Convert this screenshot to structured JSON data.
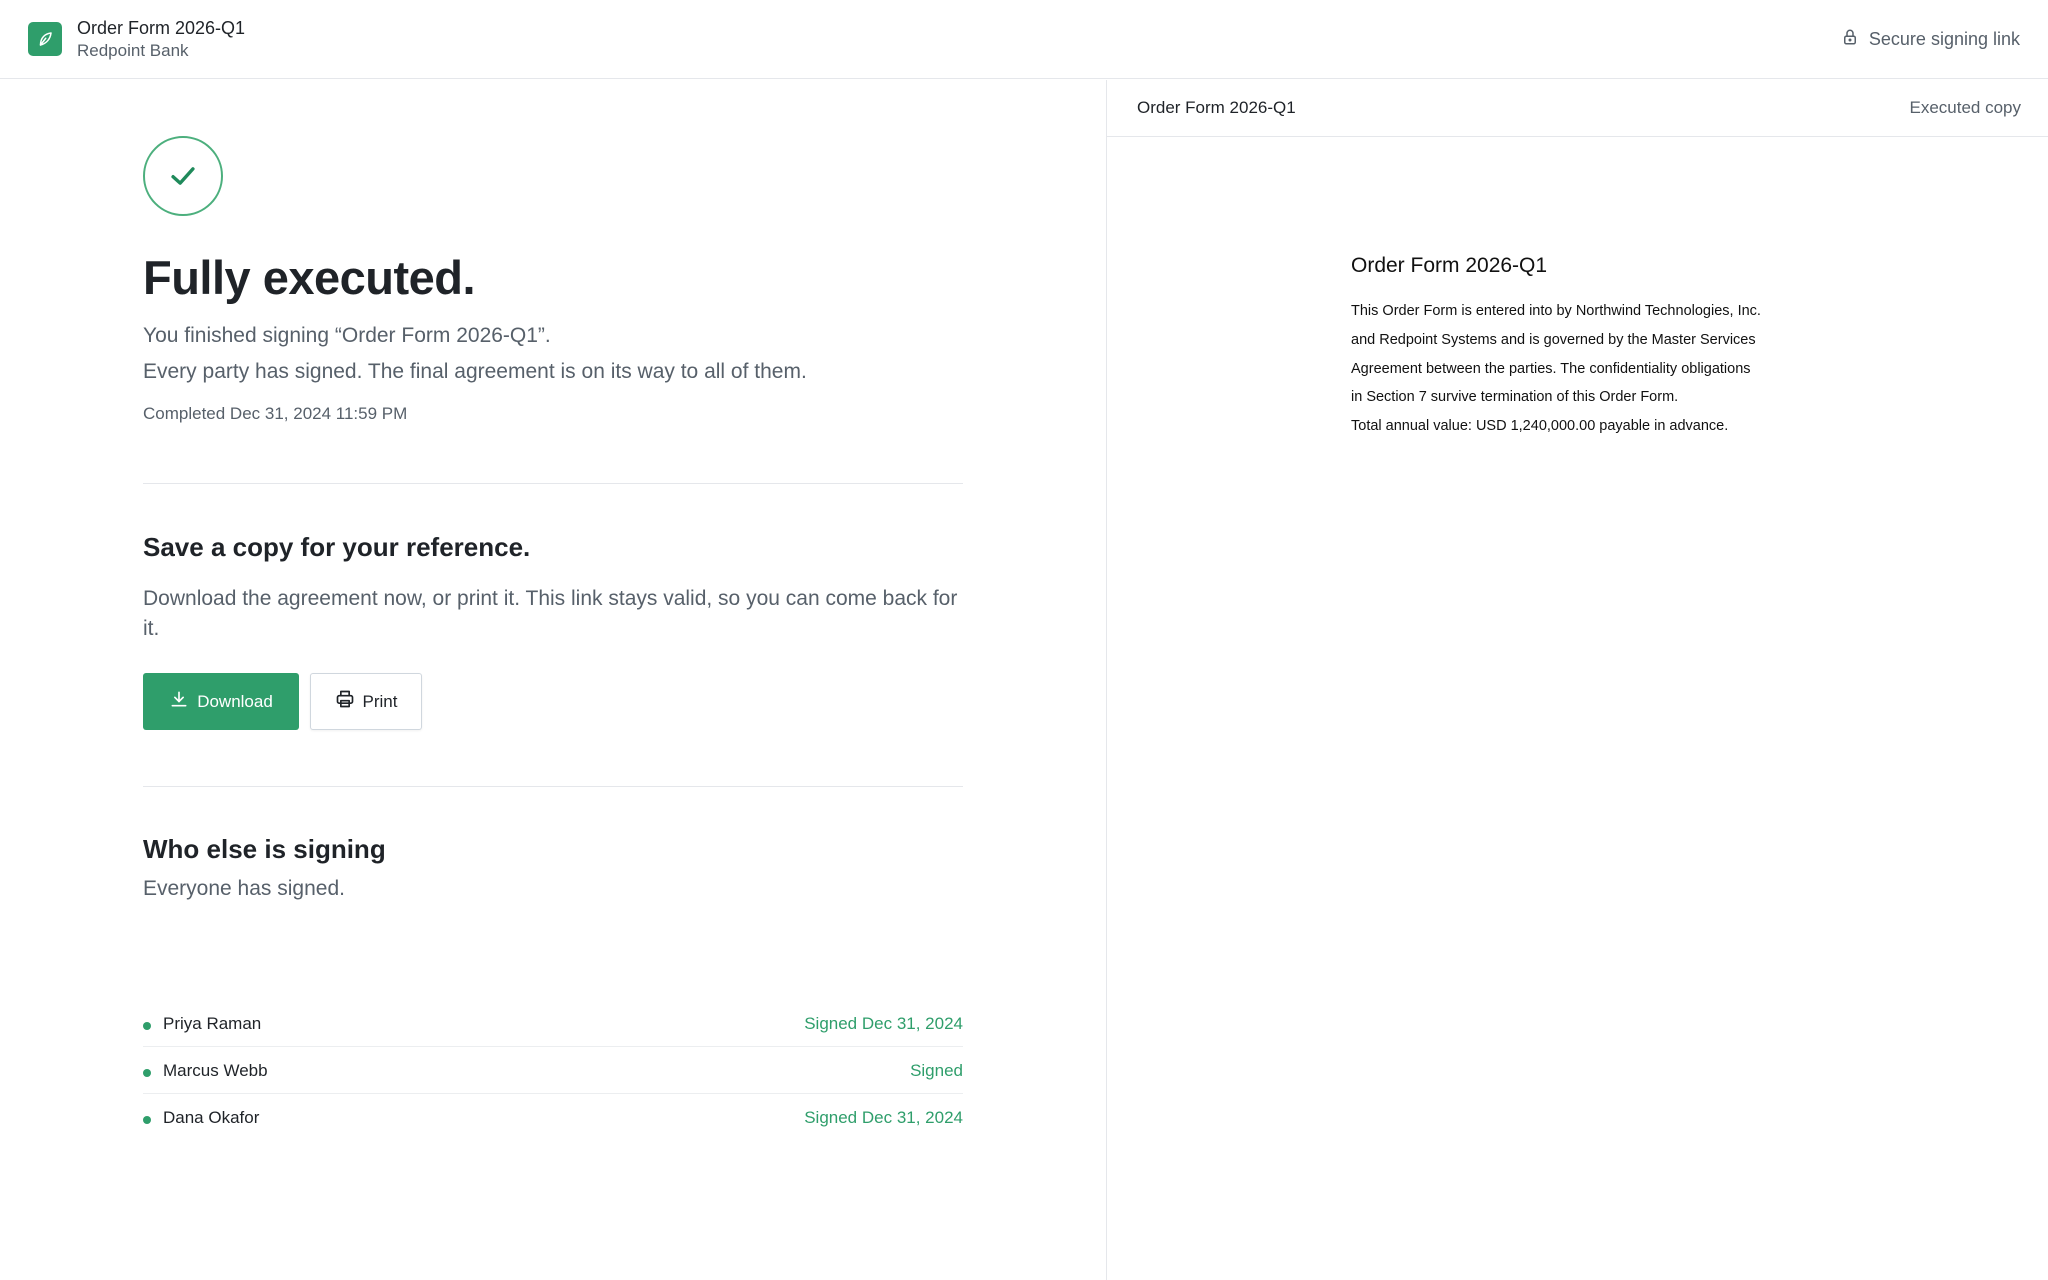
{
  "header": {
    "doc_title": "Order Form 2026-Q1",
    "org_name": "Redpoint Bank",
    "secure_label": "Secure signing link"
  },
  "status": {
    "headline": "Fully executed.",
    "line1": "You finished signing “Order Form 2026-Q1”.",
    "line2": "Every party has signed. The final agreement is on its way to all of them.",
    "completed": "Completed Dec 31, 2024 11:59 PM"
  },
  "save": {
    "title": "Save a copy for your reference.",
    "description": "Download the agreement now, or print it. This link stays valid, so you can come back for it.",
    "download_label": "Download",
    "print_label": "Print"
  },
  "signers_section": {
    "title": "Who else is signing",
    "subtitle": "Everyone has signed.",
    "signers": [
      {
        "name": "Priya Raman",
        "status": "Signed Dec 31, 2024"
      },
      {
        "name": "Marcus Webb",
        "status": "Signed"
      },
      {
        "name": "Dana Okafor",
        "status": "Signed Dec 31, 2024"
      }
    ]
  },
  "preview": {
    "title": "Order Form 2026-Q1",
    "badge": "Executed copy",
    "paper_title": "Order Form 2026-Q1",
    "lines": [
      "This Order Form is entered into by Northwind Technologies, Inc.",
      "and Redpoint Systems and is governed by the Master Services",
      "Agreement between the parties. The confidentiality obligations",
      "in Section 7 survive termination of this Order Form.",
      "Total annual value: USD 1,240,000.00 payable in advance."
    ]
  },
  "colors": {
    "accent": "#2f9e6b",
    "text": "#1f2328",
    "muted": "#57606a",
    "border": "#e5e7eb"
  },
  "icons": {
    "logo": "leaf-icon",
    "secure": "lock-icon",
    "status": "check-icon",
    "download": "download-icon",
    "print": "printer-icon"
  }
}
